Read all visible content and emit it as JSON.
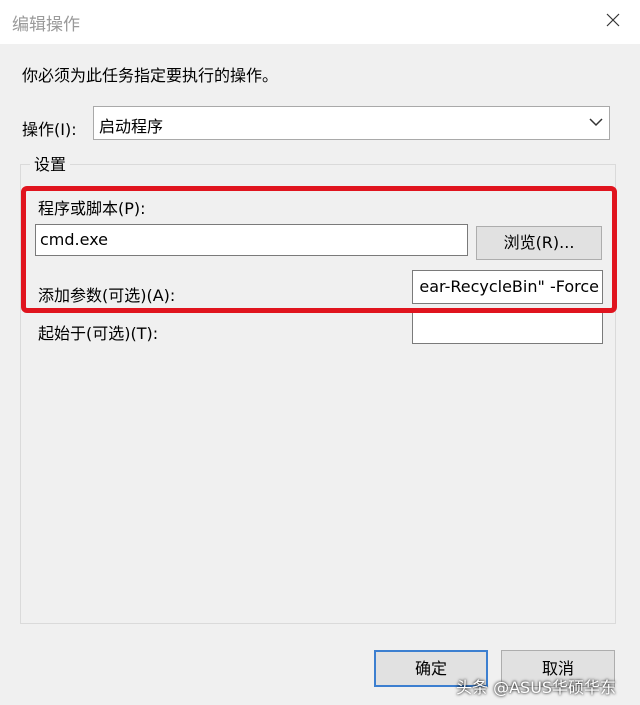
{
  "window": {
    "title": "编辑操作"
  },
  "instruction": "你必须为此任务指定要执行的操作。",
  "action": {
    "label": "操作(I):",
    "selected": "启动程序"
  },
  "settings": {
    "legend": "设置",
    "program": {
      "label": "程序或脚本(P):",
      "value": "cmd.exe",
      "browse_label": "浏览(R)..."
    },
    "arguments": {
      "label": "添加参数(可选)(A):",
      "value": "ear-RecycleBin\" -Force"
    },
    "start_in": {
      "label": "起始于(可选)(T):",
      "value": ""
    }
  },
  "buttons": {
    "ok": "确定",
    "cancel": "取消"
  },
  "watermark": "头条 @ASUS华硕华东",
  "colors": {
    "highlight": "#e0141e",
    "focus_border": "#3c7fd0"
  },
  "icons": {
    "close": "close-icon",
    "dropdown": "chevron-down-icon"
  }
}
